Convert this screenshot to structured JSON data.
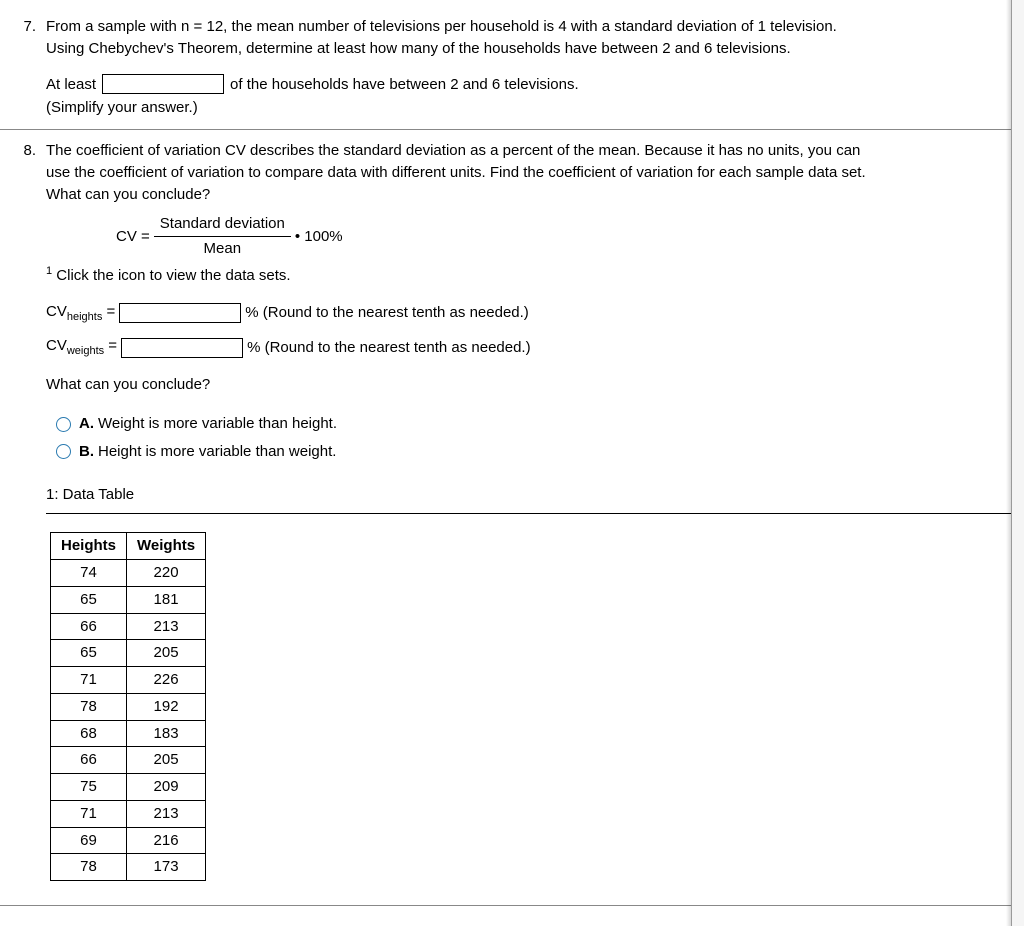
{
  "q7": {
    "number": "7.",
    "prompt_l1": "From a sample with n = 12, the mean number of televisions per household is 4 with a standard deviation of 1 television.",
    "prompt_l2": "Using Chebychev's Theorem, determine at least how many of the households have between 2 and 6 televisions.",
    "atleast_pre": "At least",
    "atleast_post": "of the households have between 2 and 6 televisions.",
    "simplify": "(Simplify your answer.)"
  },
  "q8": {
    "number": "8.",
    "prompt_l1": "The coefficient of variation CV describes the standard deviation as a percent of the mean. Because it has no units, you can",
    "prompt_l2": "use the coefficient of variation to compare data with different units. Find the coefficient of variation for each sample data set.",
    "prompt_l3": "What can you conclude?",
    "cv_eq": "CV =",
    "sd": "Standard deviation",
    "mean": "Mean",
    "pct100": "• 100%",
    "click_icon": " Click the icon to view the data sets.",
    "cv_heights_label": "CV",
    "cv_heights_sub": "heights",
    "cv_weights_sub": "weights",
    "equals": " = ",
    "round_note": "% (Round to the nearest tenth as needed.)",
    "conclude": "What can you conclude?",
    "optionA_label": "A.",
    "optionA_text": "Weight is more variable than height.",
    "optionB_label": "B.",
    "optionB_text": "Height is more variable than weight.",
    "table_title": "1: Data Table",
    "col_heights": "Heights",
    "col_weights": "Weights"
  },
  "chart_data": {
    "type": "table",
    "columns": [
      "Heights",
      "Weights"
    ],
    "rows": [
      [
        74,
        220
      ],
      [
        65,
        181
      ],
      [
        66,
        213
      ],
      [
        65,
        205
      ],
      [
        71,
        226
      ],
      [
        78,
        192
      ],
      [
        68,
        183
      ],
      [
        66,
        205
      ],
      [
        75,
        209
      ],
      [
        71,
        213
      ],
      [
        69,
        216
      ],
      [
        78,
        173
      ]
    ]
  }
}
